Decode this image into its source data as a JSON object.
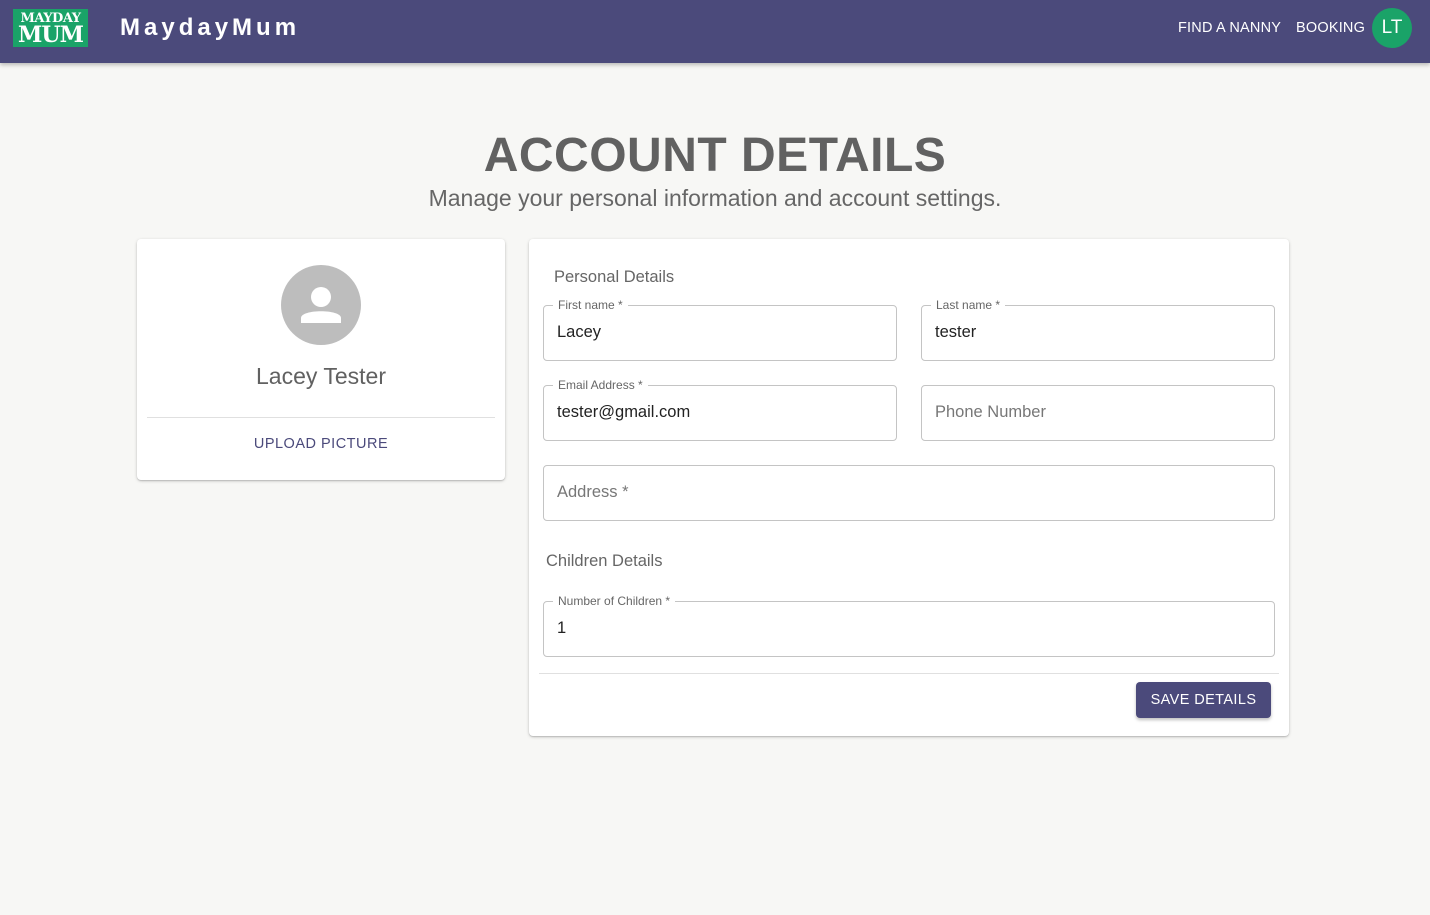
{
  "header": {
    "logo_line1": "MAYDAY",
    "logo_line2": "MUM",
    "brand": "MaydayMum",
    "nav": [
      "FIND A NANNY",
      "BOOKING"
    ],
    "user_initials": "LT"
  },
  "page": {
    "title": "ACCOUNT DETAILS",
    "subtitle": "Manage your personal information and account settings."
  },
  "profile": {
    "name": "Lacey Tester",
    "avatar_icon": "person-icon",
    "upload_label": "UPLOAD PICTURE"
  },
  "form": {
    "personal_heading": "Personal Details",
    "first_name": {
      "label": "First name *",
      "value": "Lacey"
    },
    "last_name": {
      "label": "Last name *",
      "value": "tester"
    },
    "email": {
      "label": "Email Address *",
      "value": "tester@gmail.com"
    },
    "phone": {
      "placeholder": "Phone Number"
    },
    "address": {
      "placeholder": "Address *"
    },
    "children_heading": "Children Details",
    "children": {
      "label": "Number of Children *",
      "value": "1"
    },
    "save_label": "SAVE DETAILS"
  },
  "colors": {
    "primary": "#4b4a7b",
    "accent_green": "#1aa368",
    "background": "#f7f7f5"
  }
}
